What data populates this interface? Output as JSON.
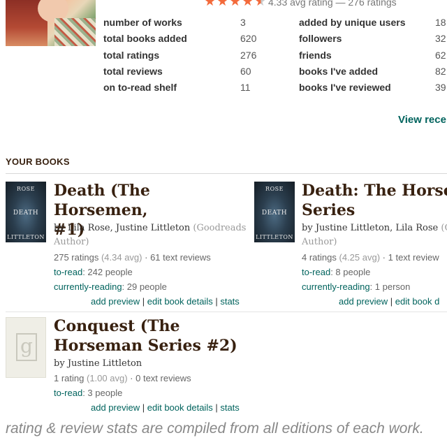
{
  "author": {
    "rating_stars": 4.33,
    "avg_rating_text": "4.33 avg rating — 276 ratings"
  },
  "stats_left": [
    {
      "label": "number of works",
      "value": "3"
    },
    {
      "label": "total books added",
      "value": "620"
    },
    {
      "label": "total ratings",
      "value": "276"
    },
    {
      "label": "total reviews",
      "value": "60"
    },
    {
      "label": "on to-read shelf",
      "value": "11"
    }
  ],
  "stats_right": [
    {
      "label": "added by unique users",
      "value": "18"
    },
    {
      "label": "followers",
      "value": "32"
    },
    {
      "label": "friends",
      "value": "62"
    },
    {
      "label": "books I've added",
      "value": "82"
    },
    {
      "label": "books I've reviewed",
      "value": "39"
    }
  ],
  "view_recent_label": "View recen",
  "section_title": "YOUR BOOKS",
  "books": [
    {
      "cover_text_top": "ROSE",
      "cover_text_mid": "DEATH",
      "cover_text_bot": "LITTLETON",
      "title_line1": "Death (The Horsemen,",
      "title_line2": "#1)",
      "by": "by",
      "authors": "Lila Rose, Justine Littleton",
      "author_note_1": "(Goodreads",
      "author_note_2": "Author)",
      "ratings": "275 ratings",
      "ratings_avg": "(4.34 avg)",
      "reviews": "· 61 text reviews",
      "to_read_label": "to-read",
      "to_read_value": ": 242 people",
      "current_label": "currently-reading",
      "current_value": ": 29 people",
      "action_preview": "add preview",
      "action_edit": "edit book details",
      "action_stats": "stats",
      "sep": "|"
    },
    {
      "cover_text_top": "ROSE",
      "cover_text_mid": "DEATH",
      "cover_text_bot": "LITTLETON",
      "title_line1": "Death: The Horsem",
      "title_line2": "Series",
      "by": "by",
      "authors": "Justine Littleton, Lila Rose",
      "author_note_1": "(Go",
      "author_note_2": "Author)",
      "ratings": "4 ratings",
      "ratings_avg": "(4.25 avg)",
      "reviews": "· 1 text review",
      "to_read_label": "to-read",
      "to_read_value": ": 8 people",
      "current_label": "currently-reading",
      "current_value": ": 1 person",
      "action_preview": "add preview",
      "action_edit": "edit book d",
      "sep": "|"
    },
    {
      "cover_letter": "g",
      "title_line1": "Conquest (The",
      "title_line2": "Horseman Series #2)",
      "by": "by",
      "authors": "Justine Littleton",
      "ratings": "1 rating",
      "ratings_avg": "(1.00 avg)",
      "reviews": "· 0 text reviews",
      "to_read_label": "to-read",
      "to_read_value": ": 3 people",
      "action_preview": "add preview",
      "action_edit": "edit book details",
      "action_stats": "stats",
      "sep": "|"
    }
  ],
  "footnote": "rating & review stats are compiled from all editions of each work.",
  "colors": {
    "accent": "#00635d",
    "heading": "#382110",
    "star": "#f36a3b"
  }
}
